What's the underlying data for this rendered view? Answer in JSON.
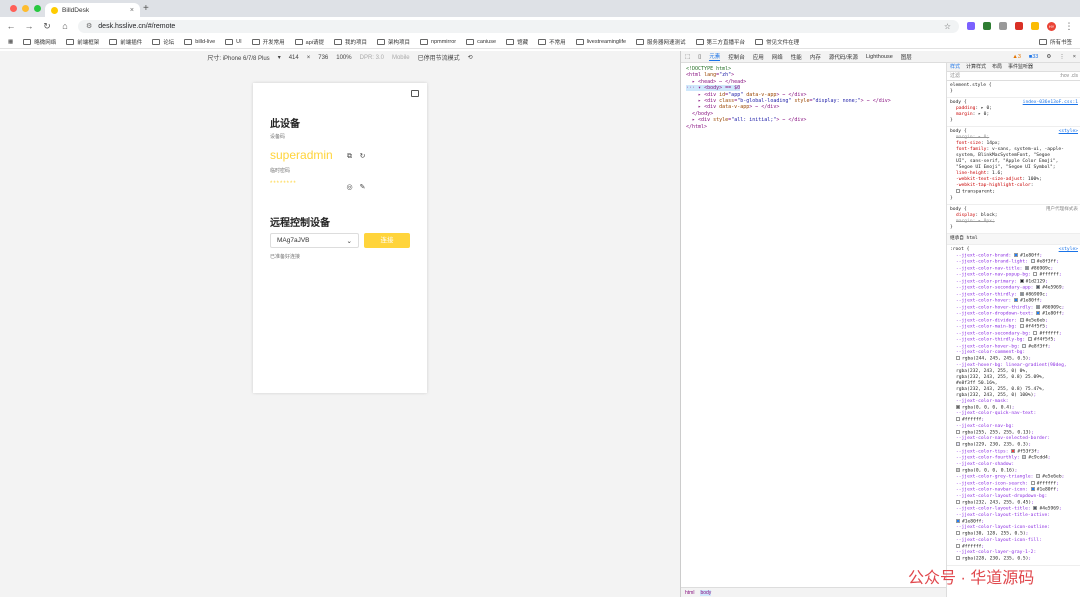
{
  "browser": {
    "tab_title": "BilldDesk",
    "url": "desk.hsslive.cn/#/remote",
    "profile_initial": "HY"
  },
  "bookmarks": [
    "略微网络",
    "前端框架",
    "前端插件",
    "论坛",
    "billd-live",
    "UI",
    "开发常用",
    "api请提",
    "我的项目",
    "架构项目",
    "npmmirror",
    "caniuse",
    "馆藏",
    "不常用",
    "livestreaminglife",
    "服务器网速测试",
    "第三方直播平台",
    "常见文件在理"
  ],
  "bookmarks_right": "所有书签",
  "device_toolbar": {
    "device": "尺寸: iPhone 6/7/8 Plus",
    "width": "414",
    "height": "736",
    "zoom": "100%",
    "dpr": "DPR: 3.0",
    "mode": "Mobile",
    "throttle": "已停用节流模式"
  },
  "app": {
    "this_device_title": "此设备",
    "device_code_label": "设备码",
    "device_code": "superadmin",
    "temp_pwd_label": "临时密码",
    "temp_pwd": "********",
    "remote_title": "远程控制设备",
    "remote_code": "MAg7aJVB",
    "connect_label": "连接",
    "status": "已准备好连接"
  },
  "devtools": {
    "tabs": [
      "元素",
      "控制台",
      "应用",
      "网络",
      "性能",
      "内存",
      "源代码/来源",
      "Lighthouse",
      "图层"
    ],
    "warnings": "3",
    "errors": "33",
    "style_tabs": [
      "样式",
      "计算样式",
      "布局",
      "事件监听器"
    ],
    "filter_placeholder": "过滤",
    "filter_hov": ":hov .cls",
    "breadcrumbs": [
      "html",
      "body"
    ],
    "inherited_label": "继承自 html",
    "colors": {
      "brand": "#1e80ff",
      "nav_title": "#86909c",
      "primary": "#1d2129"
    }
  },
  "watermark": "公众号 · 华道源码"
}
